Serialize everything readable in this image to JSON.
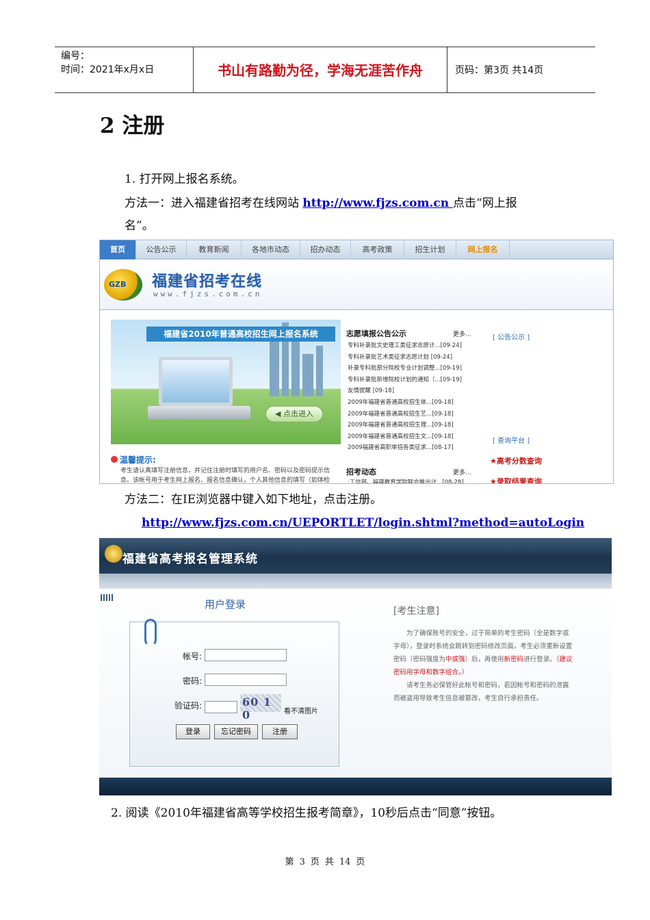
{
  "header": {
    "number_label": "编号：",
    "date_label": "时间：2021年x月x日",
    "motto": "书山有路勤为径，学海无涯苦作舟",
    "page_label": "页码：第3页  共14页"
  },
  "section_title": "2  注册",
  "step1": "1.  打开网上报名系统。",
  "method1_prefix": "方法一：进入福建省招考在线网站 ",
  "method1_link": "http://www.fjzs.com.cn ",
  "method1_suffix": "点击“网上报",
  "method1_wrap": "名”。",
  "site": {
    "tabs": [
      "首页",
      "公告公示",
      "教育新闻",
      "各地市动态",
      "招办动态",
      "高考政策",
      "招生计划",
      "网上报名"
    ],
    "logo_badge": "GZB",
    "logo_title": "福建省招考在线",
    "logo_url": "www.fjzs.com.cn",
    "promo_ribbon": "福建省2010年普通高校招生网上报名系统",
    "enter_button": "点击进入",
    "tips_title": "温馨提示:",
    "tips_text": "考生请认真填写注册信息，并记住注册时填写的用户名、密码以及密码提示信息。该帐号用于考生网上报名、报名信息确认，个人其他信息的填写（如体检",
    "notice_title": "志愿填报公告公示",
    "more": "更多...",
    "notice_items": [
      "专科补录批文史理工类征求志愿计...[09-24]",
      "专科补录批艺术类征求志愿计划 [09-24]",
      "补录专科批部分院校专业计划调整...[09-19]",
      "专科补录批新增院校计划的通知（...[09-19]",
      "友情提醒 [09-18]",
      "2009年福建省普通高校招生体...[09-18]",
      "2009年福建省普通高校招生艺...[09-18]",
      "2009年福建省普通高校招生理...[09-18]",
      "2009年福建省普通高校招生文...[09-18]",
      "2009福建省高职单招各类征求...[08-17]"
    ],
    "news_title": "招考动态",
    "news_more": "更多...",
    "news_item": "·工信部、福建教育学院联合推出计...[08-28]",
    "side_notice": "[ 公告公示 ]",
    "side_query": "[ 查询平台 ]",
    "score_link": "★高考分数查询",
    "admission_link": "★录取结果查询"
  },
  "method2": "方法二：在IE浏览器中键入如下地址，点击注册。",
  "method2_link": "http://www.fjzs.com.cn/UEPORTLET/login.shtml?method=autoLogin",
  "login": {
    "system_title": "福建省高考报名管理系统",
    "panel_title": "用户登录",
    "account_label": "帐号:",
    "password_label": "密码:",
    "captcha_label": "验证码:",
    "captcha_text": "60 1 0",
    "unclear": "看不清图片",
    "login_button": "登录",
    "forgot_button": "忘记密码",
    "register_button": "注册",
    "notice_title": "[考生注意]",
    "notice_p1a": "为了确保账号的安全，过于简单的考生密码（全是数字或字母），登录时系统会跳转到密码修改页面，考生必须重新设置密码（密码强度为",
    "notice_p1_strength": "中或强",
    "notice_p1b": "）后，再使用",
    "notice_p1_new": "新密码",
    "notice_p1c": "进行登录。",
    "notice_p1_tip": "（建议密码用字母和数字组合。）",
    "notice_p2": "请考生务必保管好此帐号和密码，若因帐号和密码的泄露而被盗用导致考生信息被篡改，考生自行承担责任。"
  },
  "step2": "2. 阅读《2010年福建省高等学校招生报考简章》，10秒后点击“同意”按钮。",
  "footer": {
    "a": "第",
    "cur": "3",
    "b": "页",
    "c": "共",
    "total": "14",
    "d": "页"
  },
  "colors": {
    "motto_red": "#d0151c",
    "link_blue": "#0000cc",
    "site_blue": "#2a5fa8"
  }
}
